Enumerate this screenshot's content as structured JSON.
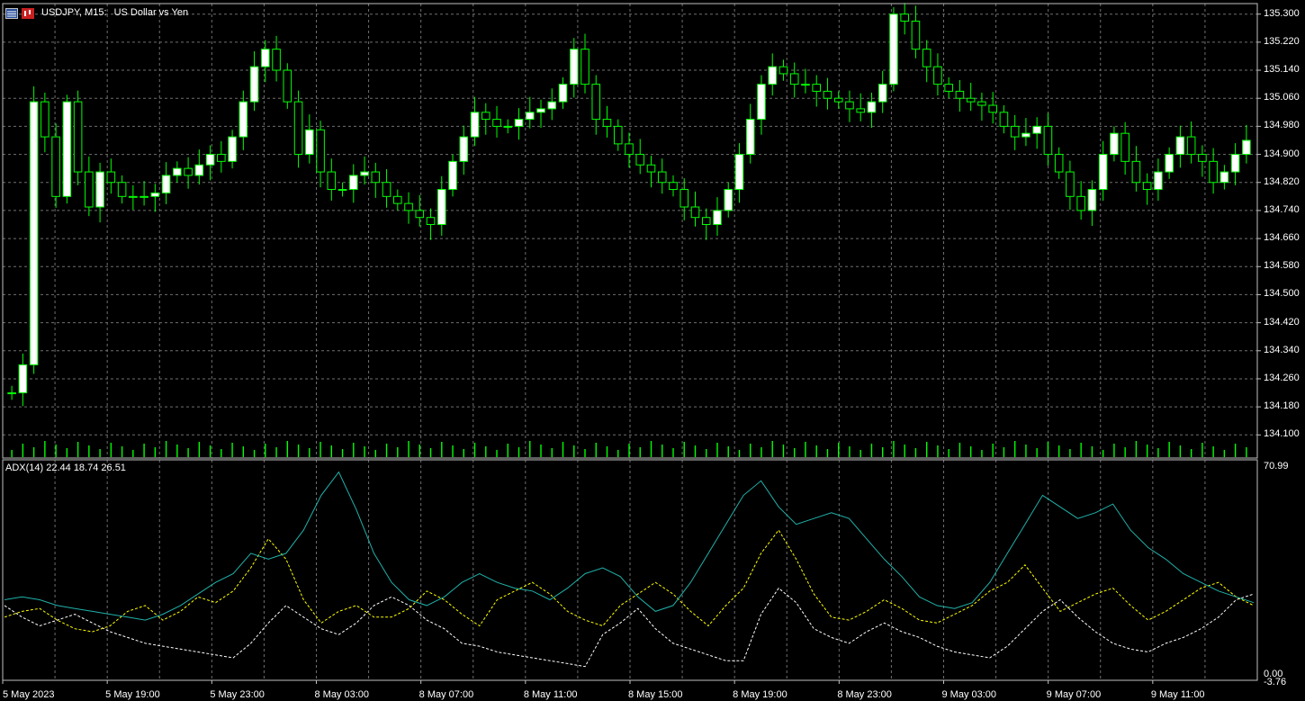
{
  "header": {
    "symbol_label": "USDJPY, M15:",
    "description": "US Dollar vs Yen",
    "icons": [
      "chart-window-icon",
      "candles-icon"
    ]
  },
  "indicator": {
    "label": "ADX(14) 22.44 18.74 26.51",
    "scale_max": "70.99",
    "scale_zero": "0.00",
    "scale_min": "-3.76"
  },
  "colors": {
    "background": "#000000",
    "grid": "#6f6f6f",
    "frame": "#c0c0c0",
    "bull_candle": "#ffffff",
    "bear_candle": "#000000",
    "candle_outline": "#00ff00",
    "volume": "#00ff00",
    "adx_line": "#20b2aa",
    "plus_di": "#ffff00",
    "minus_di": "#ffffff"
  },
  "chart_data": {
    "type": "candlestick",
    "price_axis": {
      "ticks": [
        "135.300",
        "135.220",
        "135.140",
        "135.060",
        "134.980",
        "134.900",
        "134.820",
        "134.740",
        "134.660",
        "134.580",
        "134.500",
        "134.420",
        "134.340",
        "134.260",
        "134.180",
        "134.100"
      ],
      "ylim": [
        134.07,
        135.33
      ]
    },
    "time_axis": {
      "ticks": [
        "5 May 2023",
        "5 May 19:00",
        "5 May 23:00",
        "8 May 03:00",
        "8 May 07:00",
        "8 May 11:00",
        "8 May 15:00",
        "8 May 19:00",
        "8 May 23:00",
        "9 May 03:00",
        "9 May 07:00",
        "9 May 11:00"
      ]
    },
    "price_series": [
      134.22,
      134.3,
      135.05,
      134.95,
      134.78,
      135.05,
      134.85,
      134.75,
      134.85,
      134.82,
      134.78,
      134.78,
      134.78,
      134.79,
      134.84,
      134.86,
      134.84,
      134.87,
      134.9,
      134.88,
      134.95,
      135.05,
      135.15,
      135.2,
      135.14,
      135.05,
      134.9,
      134.97,
      134.85,
      134.8,
      134.8,
      134.84,
      134.85,
      134.82,
      134.78,
      134.76,
      134.74,
      134.72,
      134.7,
      134.8,
      134.88,
      134.95,
      135.02,
      135.0,
      134.98,
      134.98,
      135.0,
      135.02,
      135.03,
      135.05,
      135.1,
      135.2,
      135.1,
      135.0,
      134.98,
      134.93,
      134.9,
      134.87,
      134.85,
      134.82,
      134.8,
      134.75,
      134.72,
      134.7,
      134.74,
      134.8,
      134.9,
      135.0,
      135.1,
      135.15,
      135.13,
      135.1,
      135.1,
      135.08,
      135.06,
      135.05,
      135.03,
      135.02,
      135.05,
      135.1,
      135.3,
      135.28,
      135.2,
      135.15,
      135.1,
      135.08,
      135.06,
      135.05,
      135.04,
      135.02,
      134.98,
      134.95,
      134.96,
      134.98,
      134.9,
      134.85,
      134.78,
      134.74,
      134.8,
      134.9,
      134.96,
      134.88,
      134.82,
      134.8,
      134.85,
      134.9,
      134.95,
      134.9,
      134.88,
      134.82,
      134.85,
      134.9,
      134.94
    ],
    "adx_series": {
      "adx": [
        24,
        25,
        24,
        22,
        21,
        20,
        19,
        18,
        17,
        19,
        22,
        26,
        30,
        33,
        40,
        38,
        40,
        48,
        60,
        68,
        55,
        40,
        30,
        24,
        22,
        25,
        30,
        33,
        30,
        28,
        27,
        24,
        28,
        33,
        35,
        32,
        25,
        20,
        22,
        30,
        40,
        50,
        60,
        65,
        56,
        50,
        52,
        54,
        52,
        45,
        38,
        32,
        25,
        22,
        21,
        23,
        30,
        40,
        50,
        60,
        56,
        52,
        54,
        57,
        48,
        42,
        38,
        33,
        30,
        27,
        25,
        23
      ],
      "plus_di": [
        18,
        20,
        21,
        17,
        14,
        13,
        15,
        20,
        22,
        17,
        20,
        25,
        23,
        27,
        35,
        45,
        38,
        24,
        16,
        20,
        22,
        18,
        18,
        21,
        27,
        24,
        19,
        15,
        24,
        27,
        30,
        26,
        20,
        17,
        15,
        22,
        26,
        30,
        26,
        20,
        15,
        22,
        28,
        40,
        48,
        38,
        26,
        18,
        17,
        20,
        24,
        21,
        17,
        16,
        19,
        22,
        27,
        30,
        36,
        28,
        20,
        23,
        26,
        28,
        22,
        17,
        20,
        24,
        28,
        30,
        25,
        22
      ],
      "minus_di": [
        22,
        18,
        15,
        17,
        19,
        16,
        13,
        11,
        9,
        8,
        7,
        6,
        5,
        4,
        9,
        16,
        22,
        18,
        14,
        12,
        16,
        22,
        25,
        22,
        17,
        14,
        9,
        8,
        6,
        5,
        4,
        3,
        2,
        1,
        12,
        16,
        21,
        14,
        9,
        7,
        5,
        3,
        3,
        19,
        28,
        23,
        14,
        11,
        9,
        13,
        16,
        13,
        11,
        8,
        6,
        5,
        4,
        8,
        14,
        20,
        24,
        18,
        13,
        9,
        7,
        6,
        9,
        11,
        14,
        18,
        24,
        26
      ]
    }
  }
}
